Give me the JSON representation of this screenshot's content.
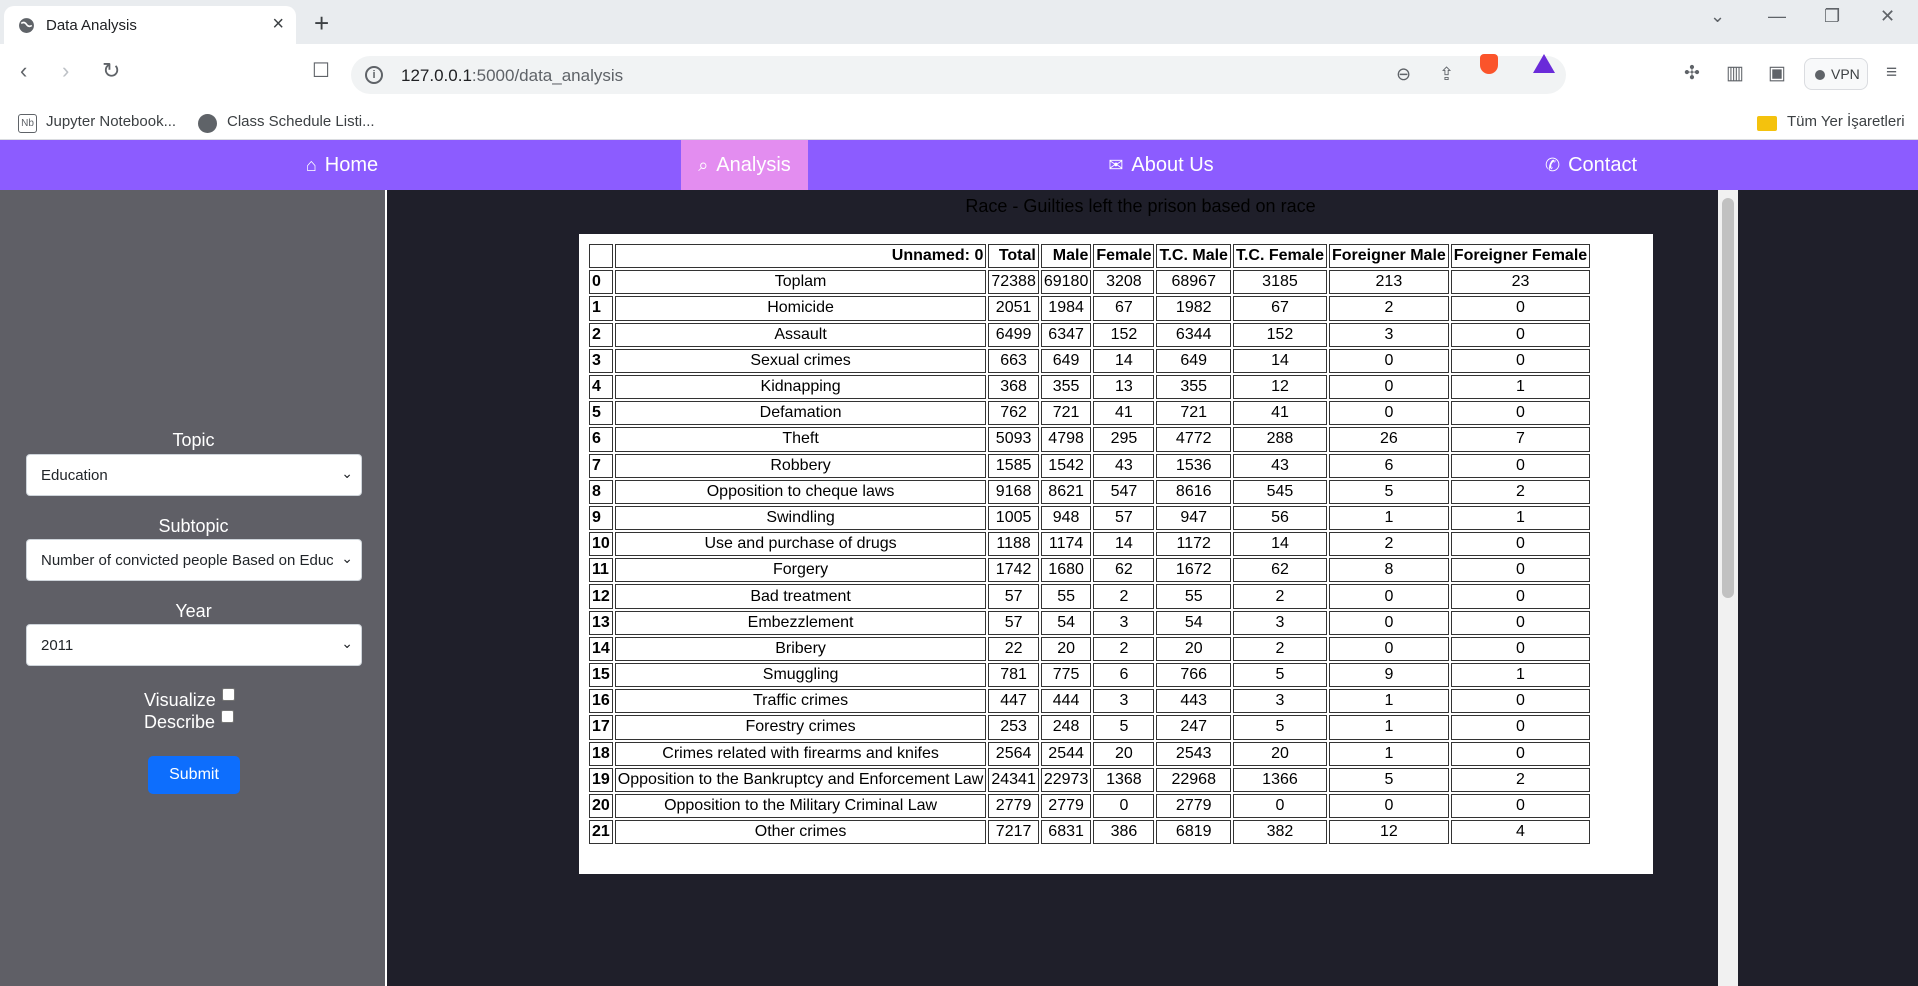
{
  "browser": {
    "tab_title": "Data Analysis",
    "url_host": "127.0.0.1",
    "url_rest": ":5000/data_analysis",
    "bookmarks": [
      "Jupyter Notebook...",
      "Class Schedule Listi...",
      "Tüm Yer İşaretleri"
    ],
    "vpn_label": "VPN"
  },
  "nav": {
    "home": "Home",
    "analysis": "Analysis",
    "about": "About Us",
    "contact": "Contact"
  },
  "sidebar": {
    "topic_label": "Topic",
    "topic_value": "Education",
    "subtopic_label": "Subtopic",
    "subtopic_value": "Number of convicted people Based on Education",
    "year_label": "Year",
    "year_value": "2011",
    "visualize_label": "Visualize",
    "describe_label": "Describe",
    "submit_label": "Submit"
  },
  "main": {
    "title": "Race - Guilties left the prison based on race"
  },
  "table": {
    "columns": [
      "",
      "Unnamed: 0",
      "Total",
      "Male",
      "Female",
      "T.C. Male",
      "T.C. Female",
      "Foreigner Male",
      "Foreigner Female"
    ],
    "rows": [
      [
        "0",
        "Toplam",
        "72388",
        "69180",
        "3208",
        "68967",
        "3185",
        "213",
        "23"
      ],
      [
        "1",
        "Homicide",
        "2051",
        "1984",
        "67",
        "1982",
        "67",
        "2",
        "0"
      ],
      [
        "2",
        "Assault",
        "6499",
        "6347",
        "152",
        "6344",
        "152",
        "3",
        "0"
      ],
      [
        "3",
        "Sexual crimes",
        "663",
        "649",
        "14",
        "649",
        "14",
        "0",
        "0"
      ],
      [
        "4",
        "Kidnapping",
        "368",
        "355",
        "13",
        "355",
        "12",
        "0",
        "1"
      ],
      [
        "5",
        "Defamation",
        "762",
        "721",
        "41",
        "721",
        "41",
        "0",
        "0"
      ],
      [
        "6",
        "Theft",
        "5093",
        "4798",
        "295",
        "4772",
        "288",
        "26",
        "7"
      ],
      [
        "7",
        "Robbery",
        "1585",
        "1542",
        "43",
        "1536",
        "43",
        "6",
        "0"
      ],
      [
        "8",
        "Opposition to cheque laws",
        "9168",
        "8621",
        "547",
        "8616",
        "545",
        "5",
        "2"
      ],
      [
        "9",
        "Swindling",
        "1005",
        "948",
        "57",
        "947",
        "56",
        "1",
        "1"
      ],
      [
        "10",
        "Use and purchase of drugs",
        "1188",
        "1174",
        "14",
        "1172",
        "14",
        "2",
        "0"
      ],
      [
        "11",
        "Forgery",
        "1742",
        "1680",
        "62",
        "1672",
        "62",
        "8",
        "0"
      ],
      [
        "12",
        "Bad treatment",
        "57",
        "55",
        "2",
        "55",
        "2",
        "0",
        "0"
      ],
      [
        "13",
        "Embezzlement",
        "57",
        "54",
        "3",
        "54",
        "3",
        "0",
        "0"
      ],
      [
        "14",
        "Bribery",
        "22",
        "20",
        "2",
        "20",
        "2",
        "0",
        "0"
      ],
      [
        "15",
        "Smuggling",
        "781",
        "775",
        "6",
        "766",
        "5",
        "9",
        "1"
      ],
      [
        "16",
        "Traffic crimes",
        "447",
        "444",
        "3",
        "443",
        "3",
        "1",
        "0"
      ],
      [
        "17",
        "Forestry crimes",
        "253",
        "248",
        "5",
        "247",
        "5",
        "1",
        "0"
      ],
      [
        "18",
        "Crimes related with firearms and knifes",
        "2564",
        "2544",
        "20",
        "2543",
        "20",
        "1",
        "0"
      ],
      [
        "19",
        "Opposition to the Bankruptcy and Enforcement Law",
        "24341",
        "22973",
        "1368",
        "22968",
        "1366",
        "5",
        "2"
      ],
      [
        "20",
        "Opposition to the Military Criminal Law",
        "2779",
        "2779",
        "0",
        "2779",
        "0",
        "0",
        "0"
      ],
      [
        "21",
        "Other crimes",
        "7217",
        "6831",
        "386",
        "6819",
        "382",
        "12",
        "4"
      ]
    ]
  }
}
